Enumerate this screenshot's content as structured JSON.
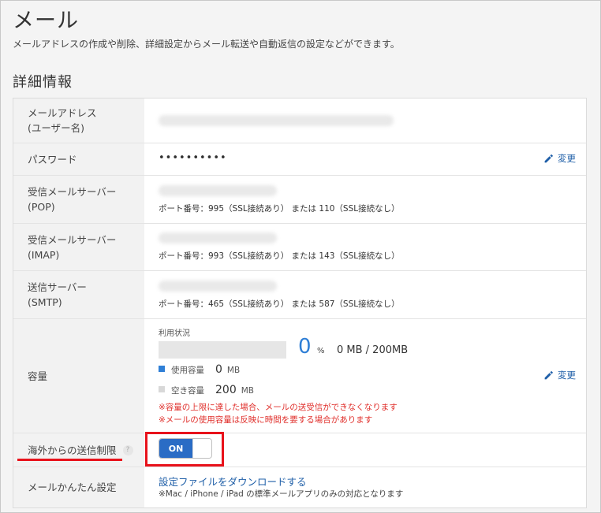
{
  "page": {
    "title": "メール",
    "description": "メールアドレスの作成や削除、詳細設定からメール転送や自動返信の設定などができます。",
    "section_title": "詳細情報"
  },
  "rows": {
    "email": {
      "label": "メールアドレス\n(ユーザー名)"
    },
    "password": {
      "label": "パスワード",
      "value": "••••••••••",
      "change": "変更"
    },
    "pop": {
      "label": "受信メールサーバー\n(POP)",
      "port": "ポート番号：995（SSL接続あり） または 110（SSL接続なし）"
    },
    "imap": {
      "label": "受信メールサーバー\n(IMAP)",
      "port": "ポート番号：993（SSL接続あり） または 143（SSL接続なし）"
    },
    "smtp": {
      "label": "送信サーバー\n(SMTP)",
      "port": "ポート番号：465（SSL接続あり） または 587（SSL接続なし）"
    },
    "capacity": {
      "label": "容量",
      "usage_label": "利用状況",
      "percent": "0",
      "percent_unit": "%",
      "total": "0 MB / 200MB",
      "used_label": "使用容量",
      "used_value": "0",
      "used_unit": "MB",
      "free_label": "空き容量",
      "free_value": "200",
      "free_unit": "MB",
      "warning1": "※容量の上限に達した場合、メールの送受信ができなくなります",
      "warning2": "※メールの使用容量は反映に時間を要する場合があります",
      "change": "変更",
      "used_fraction": 0
    },
    "overseas": {
      "label": "海外からの送信制限",
      "help": "?",
      "toggle": "ON"
    },
    "easy": {
      "label": "メールかんたん設定",
      "link": "設定ファイルをダウンロードする",
      "note": "※Mac / iPhone / iPad の標準メールアプリのみの対応となります"
    }
  },
  "colors": {
    "accent": "#2a6cc5",
    "link": "#1f5fa8",
    "warning": "#e0302c",
    "highlight": "#e8121b",
    "used_square": "#2f7fd6",
    "free_square": "#d8d8d8"
  }
}
